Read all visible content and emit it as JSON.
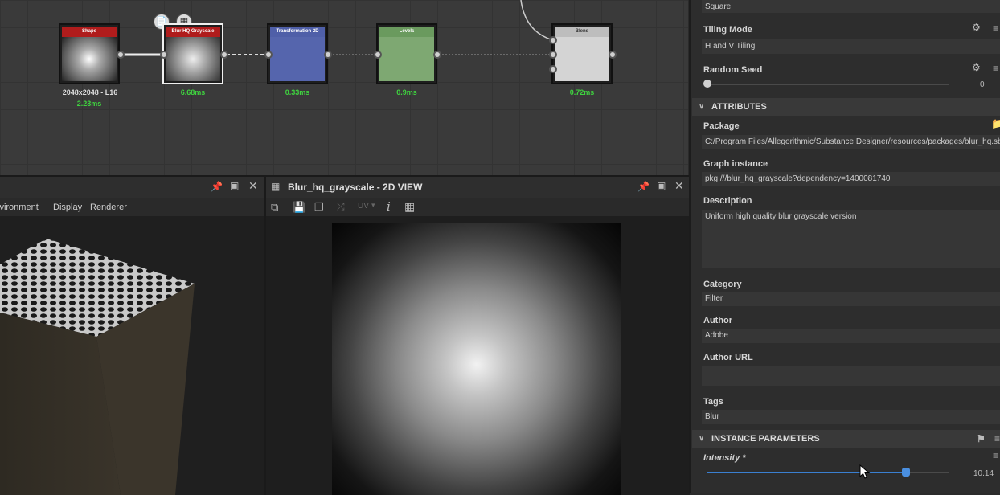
{
  "graph": {
    "nodes": [
      {
        "title": "Shape",
        "time": "2.23ms",
        "resolution": "2048x2048 - L16"
      },
      {
        "title": "Blur HQ Grayscale",
        "time": "6.68ms"
      },
      {
        "title": "Transformation 2D",
        "time": "0.33ms"
      },
      {
        "title": "Levels",
        "time": "0.9ms"
      },
      {
        "title": "Blend",
        "time": "0.72ms"
      }
    ]
  },
  "view3d": {
    "menu": [
      "Environment",
      "Display",
      "Renderer"
    ]
  },
  "view2d": {
    "title": "Blur_hq_grayscale - 2D VIEW",
    "uv_label": "UV"
  },
  "properties": {
    "shape_value": "Square",
    "tiling_mode": {
      "label": "Tiling Mode",
      "value": "H and V Tiling"
    },
    "random_seed": {
      "label": "Random Seed",
      "value": "0"
    },
    "attributes_header": "ATTRIBUTES",
    "package": {
      "label": "Package",
      "value": "C:/Program Files/Allegorithmic/Substance Designer/resources/packages/blur_hq.sbs"
    },
    "graph_instance": {
      "label": "Graph instance",
      "value": "pkg:///blur_hq_grayscale?dependency=1400081740"
    },
    "description": {
      "label": "Description",
      "value": "Uniform high quality blur grayscale version"
    },
    "category": {
      "label": "Category",
      "value": "Filter"
    },
    "author": {
      "label": "Author",
      "value": "Adobe"
    },
    "author_url": {
      "label": "Author URL",
      "value": ""
    },
    "tags": {
      "label": "Tags",
      "value": "Blur"
    },
    "instance_header": "INSTANCE PARAMETERS",
    "intensity": {
      "label": "Intensity *",
      "value": "10.14",
      "fraction": 0.82
    }
  }
}
